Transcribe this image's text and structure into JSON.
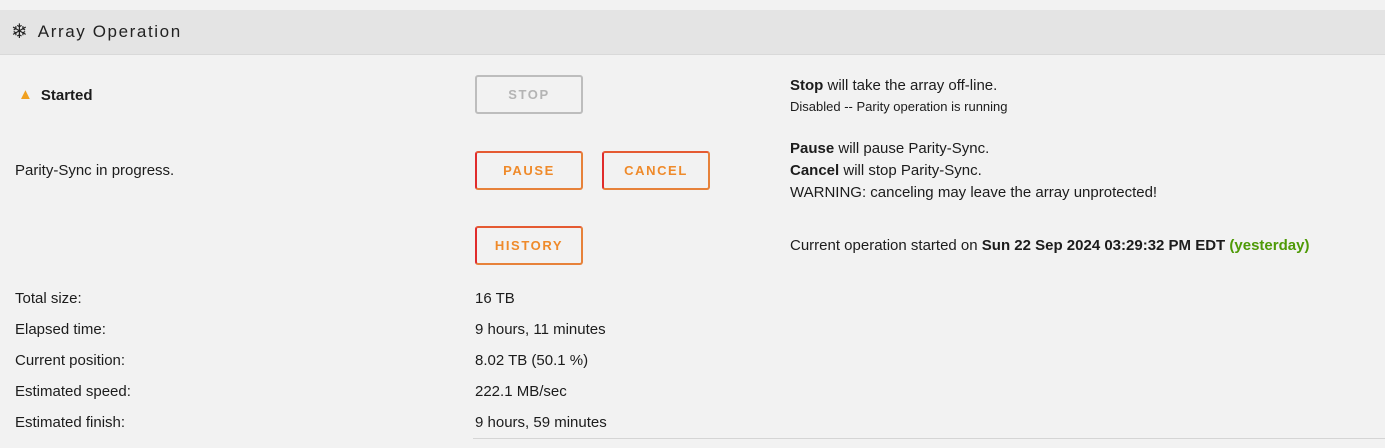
{
  "header": {
    "icon": "snowflake-icon",
    "title": "Array Operation"
  },
  "status": {
    "icon": "warning-icon",
    "label": "Started"
  },
  "stop": {
    "button_label": "STOP",
    "desc_bold": "Stop",
    "desc_rest": " will take the array off-line.",
    "desc_note": "Disabled -- Parity operation is running"
  },
  "parity": {
    "label": "Parity-Sync in progress.",
    "pause_label": "PAUSE",
    "cancel_label": "CANCEL",
    "pause_desc_bold": "Pause",
    "pause_desc_rest": " will pause Parity-Sync.",
    "cancel_desc_bold": "Cancel",
    "cancel_desc_rest": " will stop Parity-Sync.",
    "warning": "WARNING: canceling may leave the array unprotected!"
  },
  "history": {
    "button_label": "HISTORY",
    "desc_prefix": "Current operation started on ",
    "desc_date": "Sun 22 Sep 2024 03:29:32 PM EDT",
    "desc_relative": "(yesterday)"
  },
  "stats": [
    {
      "label": "Total size:",
      "value": "16 TB"
    },
    {
      "label": "Elapsed time:",
      "value": "9 hours, 11 minutes"
    },
    {
      "label": "Current position:",
      "value": "8.02 TB (50.1 %)"
    },
    {
      "label": "Estimated speed:",
      "value": "222.1 MB/sec"
    },
    {
      "label": "Estimated finish:",
      "value": "9 hours, 59 minutes"
    }
  ],
  "colors": {
    "accent_orange": "#ef8a2a",
    "accent_red": "#e02c2c",
    "warning_yellow": "#f0a020",
    "success_green": "#4e9a06"
  }
}
